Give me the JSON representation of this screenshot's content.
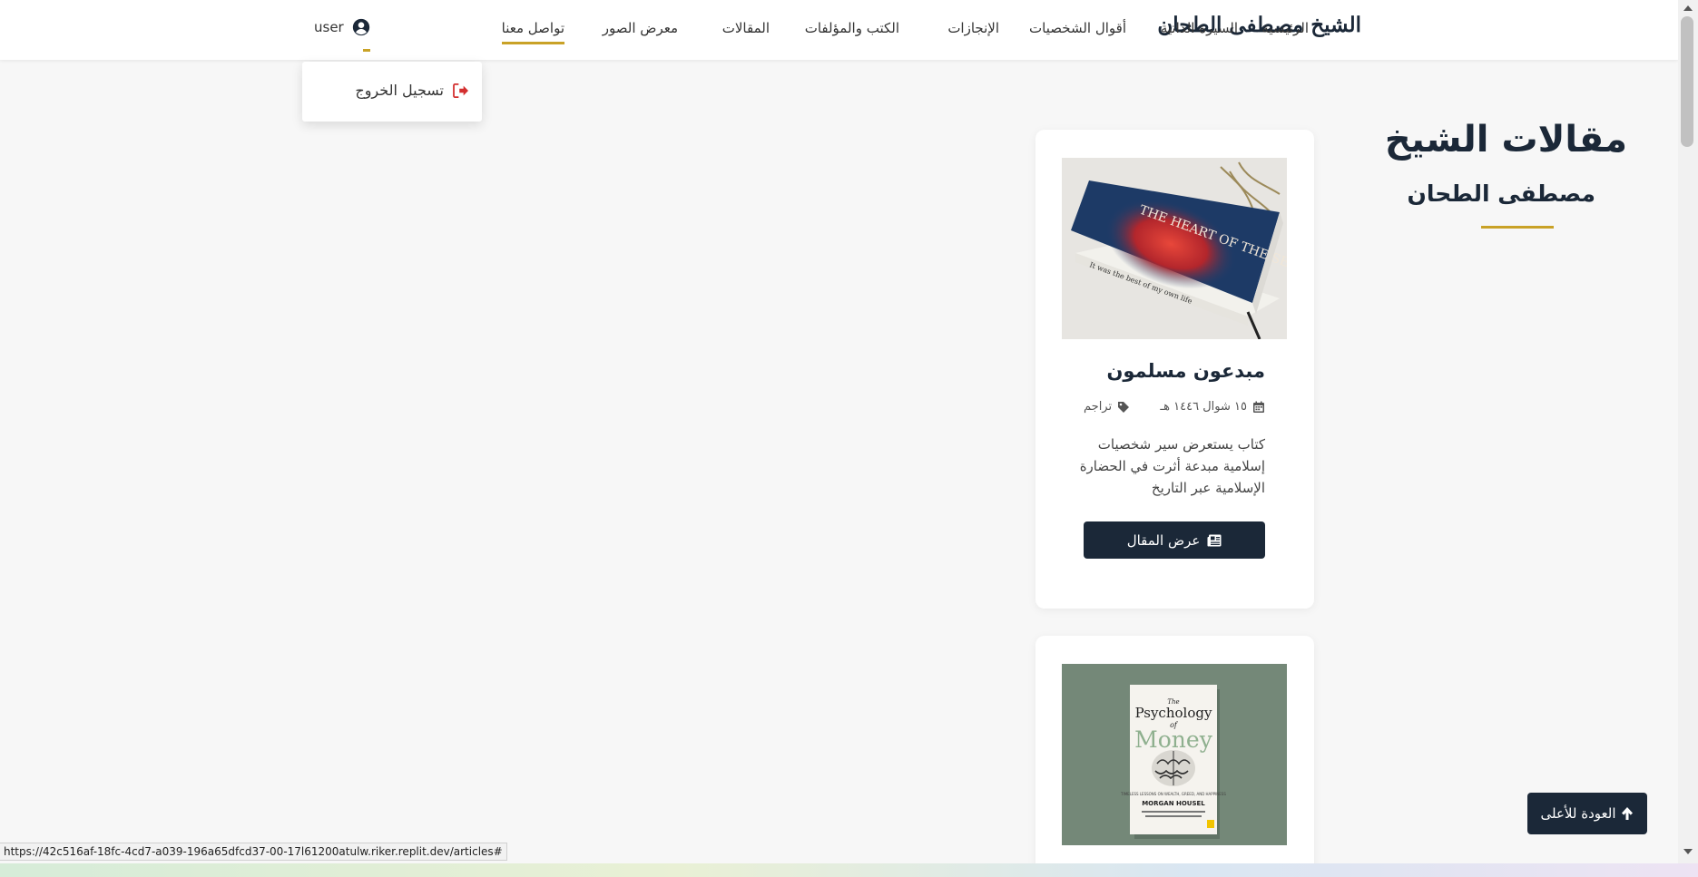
{
  "navbar": {
    "brand": "الشيخ مصطفى الطحان",
    "items": [
      {
        "label": "الرئيسية",
        "active": false
      },
      {
        "label": "السيرة الذاتية",
        "active": false
      },
      {
        "label": "أقوال الشخصيات",
        "active": false
      },
      {
        "label": "الإنجازات",
        "active": false
      },
      {
        "label": "الكتب والمؤلفات",
        "active": false
      },
      {
        "label": "المقالات",
        "active": false
      },
      {
        "label": "معرض الصور",
        "active": false
      },
      {
        "label": "تواصل معنا",
        "active": true
      }
    ],
    "user": {
      "name": "user",
      "icon": "user-circle-icon"
    }
  },
  "dropdown": {
    "logout_label": "تسجيل الخروج",
    "logout_icon": "sign-out-icon"
  },
  "header": {
    "title": "مقالات الشيخ",
    "subtitle": "مصطفى الطحان"
  },
  "articles": [
    {
      "title": "مبدعون مسلمون",
      "date": "١٥ شوال ١٤٤٦ هـ",
      "category": "تراجم",
      "excerpt": "كتاب يستعرض سير شخصيات إسلامية مبدعة أثرت في الحضارة الإسلامية عبر التاريخ",
      "button_label": "عرض المقال",
      "cover": {
        "book_title": "THE HEART OF THE SEA",
        "spine_text": "It was the best of my own life"
      }
    },
    {
      "cover": {
        "book_title_line1": "The",
        "book_title_line2": "Psychology",
        "book_title_line3": "of",
        "book_title_line4": "Money",
        "book_subtitle": "TIMELESS LESSONS ON WEALTH, GREED, AND HAPPINESS",
        "author": "MORGAN HOUSEL"
      }
    }
  ],
  "back_to_top": {
    "label": "العودة للأعلى",
    "icon": "arrow-up-icon"
  },
  "status_bar": {
    "url": "https://42c516af-18fc-4cd7-a039-196a65dfcd37-00-17l61200atulw.riker.replit.dev/articles#"
  },
  "colors": {
    "navy": "#1b2838",
    "gold": "#c9a227",
    "background": "#f7f7f7",
    "logout_red": "#d32f2f"
  }
}
